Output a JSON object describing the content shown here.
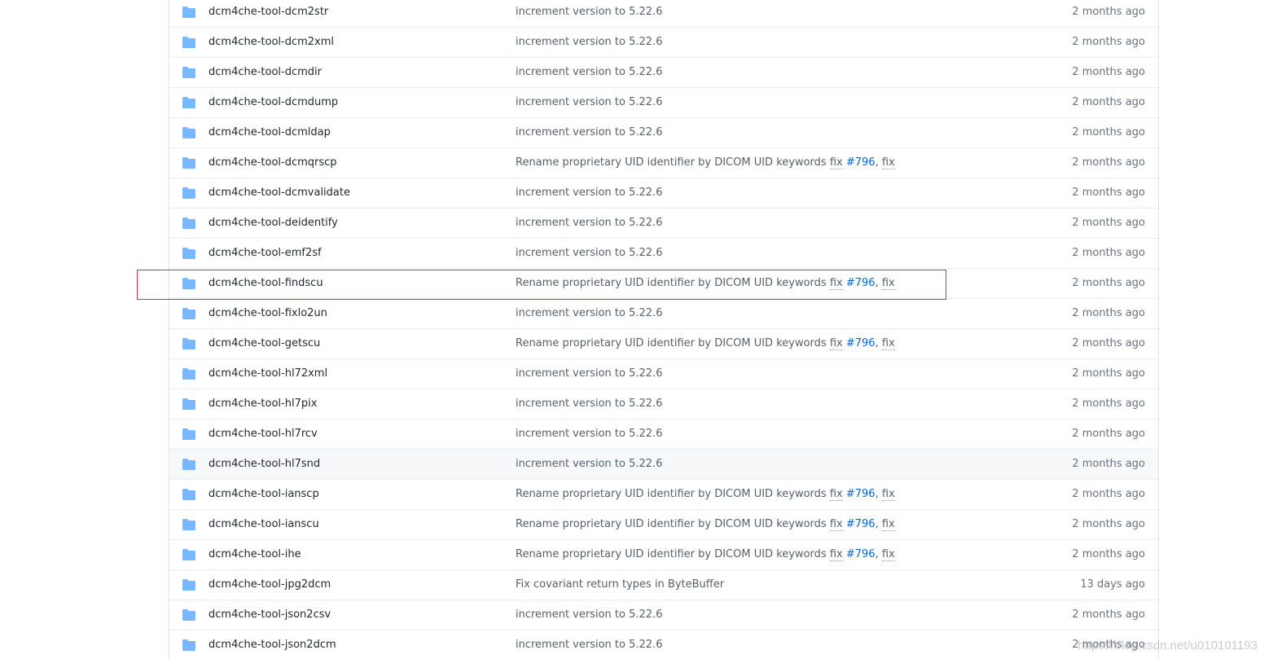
{
  "colors": {
    "folder": "#79b8ff",
    "link": "#0366d6",
    "highlight_box": "#d9333f",
    "row_hover": "#f6f8fa"
  },
  "rows": [
    {
      "name": "dcm4che-tool-dcm2str",
      "message": "increment version to 5.22.6",
      "age": "2 months ago"
    },
    {
      "name": "dcm4che-tool-dcm2xml",
      "message": "increment version to 5.22.6",
      "age": "2 months ago"
    },
    {
      "name": "dcm4che-tool-dcmdir",
      "message": "increment version to 5.22.6",
      "age": "2 months ago"
    },
    {
      "name": "dcm4che-tool-dcmdump",
      "message": "increment version to 5.22.6",
      "age": "2 months ago"
    },
    {
      "name": "dcm4che-tool-dcmldap",
      "message": "increment version to 5.22.6",
      "age": "2 months ago"
    },
    {
      "name": "dcm4che-tool-dcmqrscp",
      "message": "Rename proprietary UID identifier by DICOM UID keywords",
      "fix1": "fix",
      "issue1": "#796",
      "sep": ",",
      "fix2": "fix",
      "issue2": "#…",
      "age": "2 months ago"
    },
    {
      "name": "dcm4che-tool-dcmvalidate",
      "message": "increment version to 5.22.6",
      "age": "2 months ago"
    },
    {
      "name": "dcm4che-tool-deidentify",
      "message": "increment version to 5.22.6",
      "age": "2 months ago"
    },
    {
      "name": "dcm4che-tool-emf2sf",
      "message": "increment version to 5.22.6",
      "age": "2 months ago"
    },
    {
      "name": "dcm4che-tool-findscu",
      "message": "Rename proprietary UID identifier by DICOM UID keywords",
      "fix1": "fix",
      "issue1": "#796",
      "sep": ",",
      "fix2": "fix",
      "issue2": "#…",
      "age": "2 months ago"
    },
    {
      "name": "dcm4che-tool-fixlo2un",
      "message": "increment version to 5.22.6",
      "age": "2 months ago"
    },
    {
      "name": "dcm4che-tool-getscu",
      "message": "Rename proprietary UID identifier by DICOM UID keywords",
      "fix1": "fix",
      "issue1": "#796",
      "sep": ",",
      "fix2": "fix",
      "issue2": "#…",
      "age": "2 months ago"
    },
    {
      "name": "dcm4che-tool-hl72xml",
      "message": "increment version to 5.22.6",
      "age": "2 months ago"
    },
    {
      "name": "dcm4che-tool-hl7pix",
      "message": "increment version to 5.22.6",
      "age": "2 months ago"
    },
    {
      "name": "dcm4che-tool-hl7rcv",
      "message": "increment version to 5.22.6",
      "age": "2 months ago"
    },
    {
      "name": "dcm4che-tool-hl7snd",
      "message": "increment version to 5.22.6",
      "age": "2 months ago",
      "hover": true
    },
    {
      "name": "dcm4che-tool-ianscp",
      "message": "Rename proprietary UID identifier by DICOM UID keywords",
      "fix1": "fix",
      "issue1": "#796",
      "sep": ",",
      "fix2": "fix",
      "issue2": "#…",
      "age": "2 months ago"
    },
    {
      "name": "dcm4che-tool-ianscu",
      "message": "Rename proprietary UID identifier by DICOM UID keywords",
      "fix1": "fix",
      "issue1": "#796",
      "sep": ",",
      "fix2": "fix",
      "issue2": "#…",
      "age": "2 months ago"
    },
    {
      "name": "dcm4che-tool-ihe",
      "message": "Rename proprietary UID identifier by DICOM UID keywords",
      "fix1": "fix",
      "issue1": "#796",
      "sep": ",",
      "fix2": "fix",
      "issue2": "#…",
      "age": "2 months ago"
    },
    {
      "name": "dcm4che-tool-jpg2dcm",
      "message": "Fix covariant return types in ByteBuffer",
      "age": "13 days ago"
    },
    {
      "name": "dcm4che-tool-json2csv",
      "message": "increment version to 5.22.6",
      "age": "2 months ago"
    },
    {
      "name": "dcm4che-tool-json2dcm",
      "message": "increment version to 5.22.6",
      "age": "2 months ago"
    }
  ],
  "watermark": "https://blog.csdn.net/u010101193"
}
